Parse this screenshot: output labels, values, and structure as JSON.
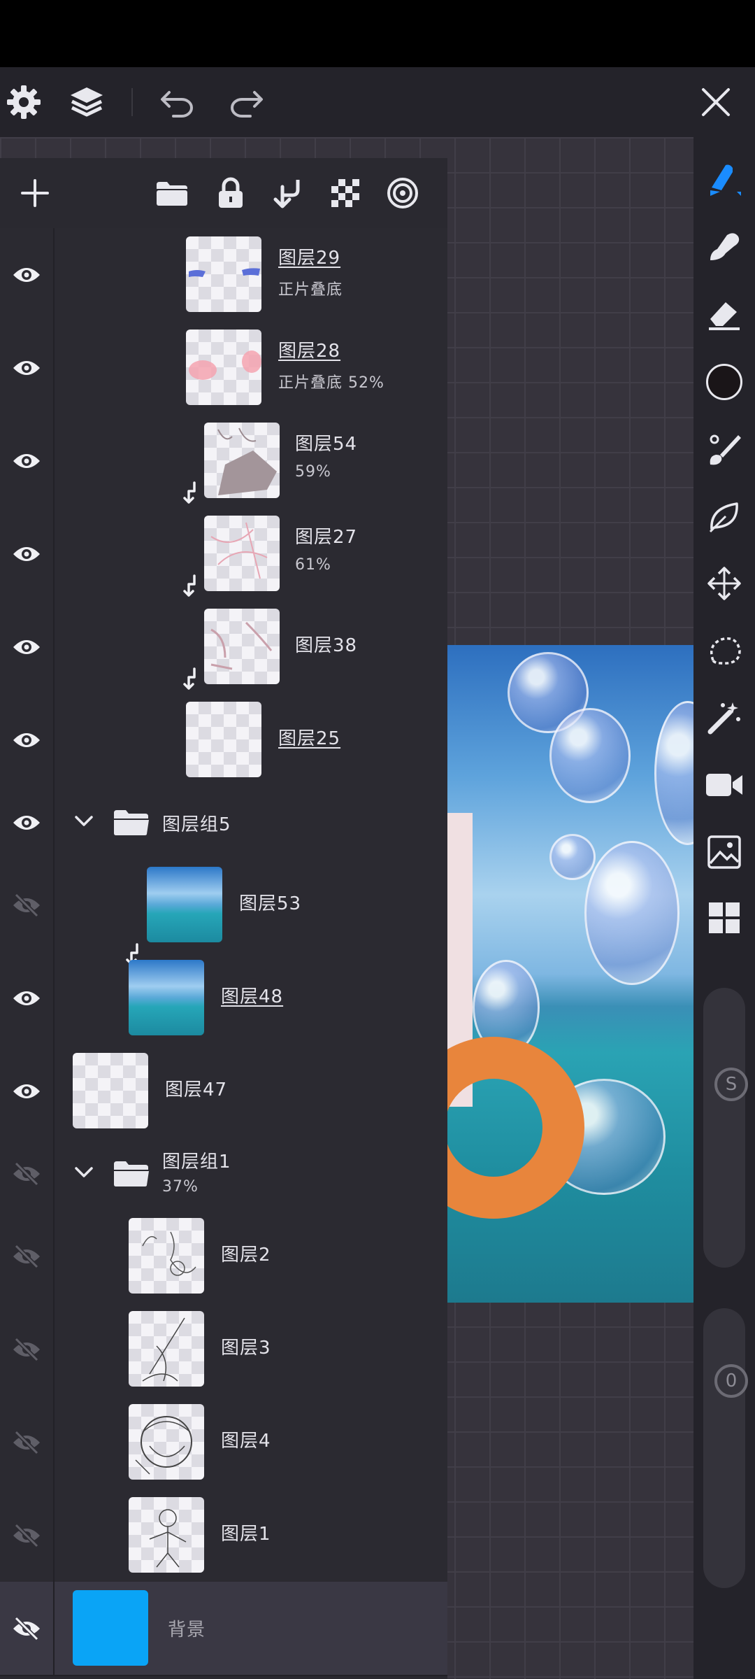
{
  "colors": {
    "accent": "#1a8cff",
    "panel": "#2a2930",
    "background_layer": "#0aa4f6"
  },
  "topbar": {
    "icons": [
      "gear-icon",
      "layers-icon",
      "undo-icon",
      "redo-icon",
      "close-icon"
    ]
  },
  "layer_toolbar": {
    "icons": [
      "add-icon",
      "folder-icon",
      "lock-icon",
      "merge-down-icon",
      "transparency-icon",
      "target-icon"
    ]
  },
  "layers": [
    {
      "name": "图层29",
      "sub": "正片叠底",
      "visible": true
    },
    {
      "name": "图层28",
      "sub": "正片叠底  52%",
      "visible": true
    },
    {
      "name": "图层54",
      "sub": "59%",
      "visible": true,
      "clipped": true
    },
    {
      "name": "图层27",
      "sub": "61%",
      "visible": true,
      "clipped": true
    },
    {
      "name": "图层38",
      "sub": "",
      "visible": true,
      "clipped": true
    },
    {
      "name": "图层25",
      "sub": "",
      "visible": true
    },
    {
      "name": "图层组5",
      "sub": "",
      "visible": true,
      "group": true
    },
    {
      "name": "图层53",
      "sub": "",
      "visible": false
    },
    {
      "name": "图层48",
      "sub": "",
      "visible": true,
      "clipped": true
    },
    {
      "name": "图层47",
      "sub": "",
      "visible": true
    },
    {
      "name": "图层组1",
      "sub": "37%",
      "visible": false,
      "group": true
    },
    {
      "name": "图层2",
      "sub": "",
      "visible": false
    },
    {
      "name": "图层3",
      "sub": "",
      "visible": false
    },
    {
      "name": "图层4",
      "sub": "",
      "visible": false
    },
    {
      "name": "图层1",
      "sub": "",
      "visible": false
    },
    {
      "name": "背景",
      "sub": "",
      "visible": false
    }
  ],
  "right_tools": {
    "icons": [
      "pen-icon",
      "smudge-icon",
      "eraser-icon",
      "color-swatch",
      "brush-icon",
      "lasso-leaf-icon",
      "move-icon",
      "selection-icon",
      "magic-wand-icon",
      "video-icon",
      "image-icon",
      "grid-icon"
    ],
    "size_label": "S",
    "opacity_label": "0"
  }
}
